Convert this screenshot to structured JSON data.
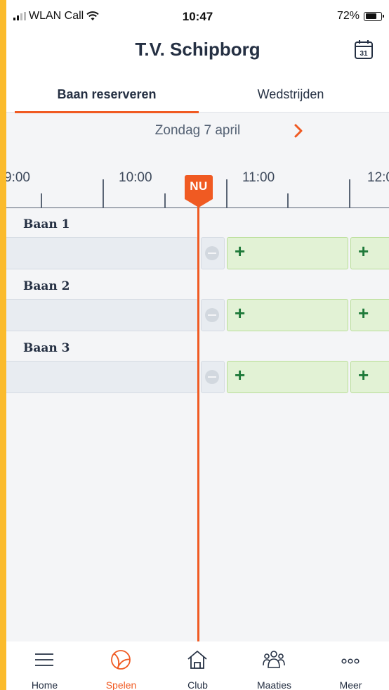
{
  "status_bar": {
    "carrier": "WLAN Call",
    "time": "10:47",
    "battery": "72%",
    "battery_level": 0.72
  },
  "header": {
    "title": "T.V. Schipborg",
    "calendar_icon_day": "31"
  },
  "tabs": [
    {
      "label": "Baan reserveren",
      "active": true
    },
    {
      "label": "Wedstrijden",
      "active": false
    }
  ],
  "date_nav": {
    "date": "Zondag 7 april"
  },
  "timeline": {
    "labels": [
      "9:00",
      "10:00",
      "11:00",
      "12:0"
    ],
    "now_label": "NU"
  },
  "courts": [
    {
      "label": "Baan 1"
    },
    {
      "label": "Baan 2"
    },
    {
      "label": "Baan 3"
    }
  ],
  "slot_add_symbol": "+",
  "bottom_nav": [
    {
      "label": "Home",
      "active": false
    },
    {
      "label": "Spelen",
      "active": true
    },
    {
      "label": "Club",
      "active": false
    },
    {
      "label": "Maaties",
      "active": false
    },
    {
      "label": "Meer",
      "active": false
    }
  ],
  "colors": {
    "accent": "#f05a22",
    "frame": "#fbbb2c",
    "free_slot": "#e2f2d5",
    "free_slot_plus": "#1f7a3a",
    "text_dark": "#253043"
  }
}
